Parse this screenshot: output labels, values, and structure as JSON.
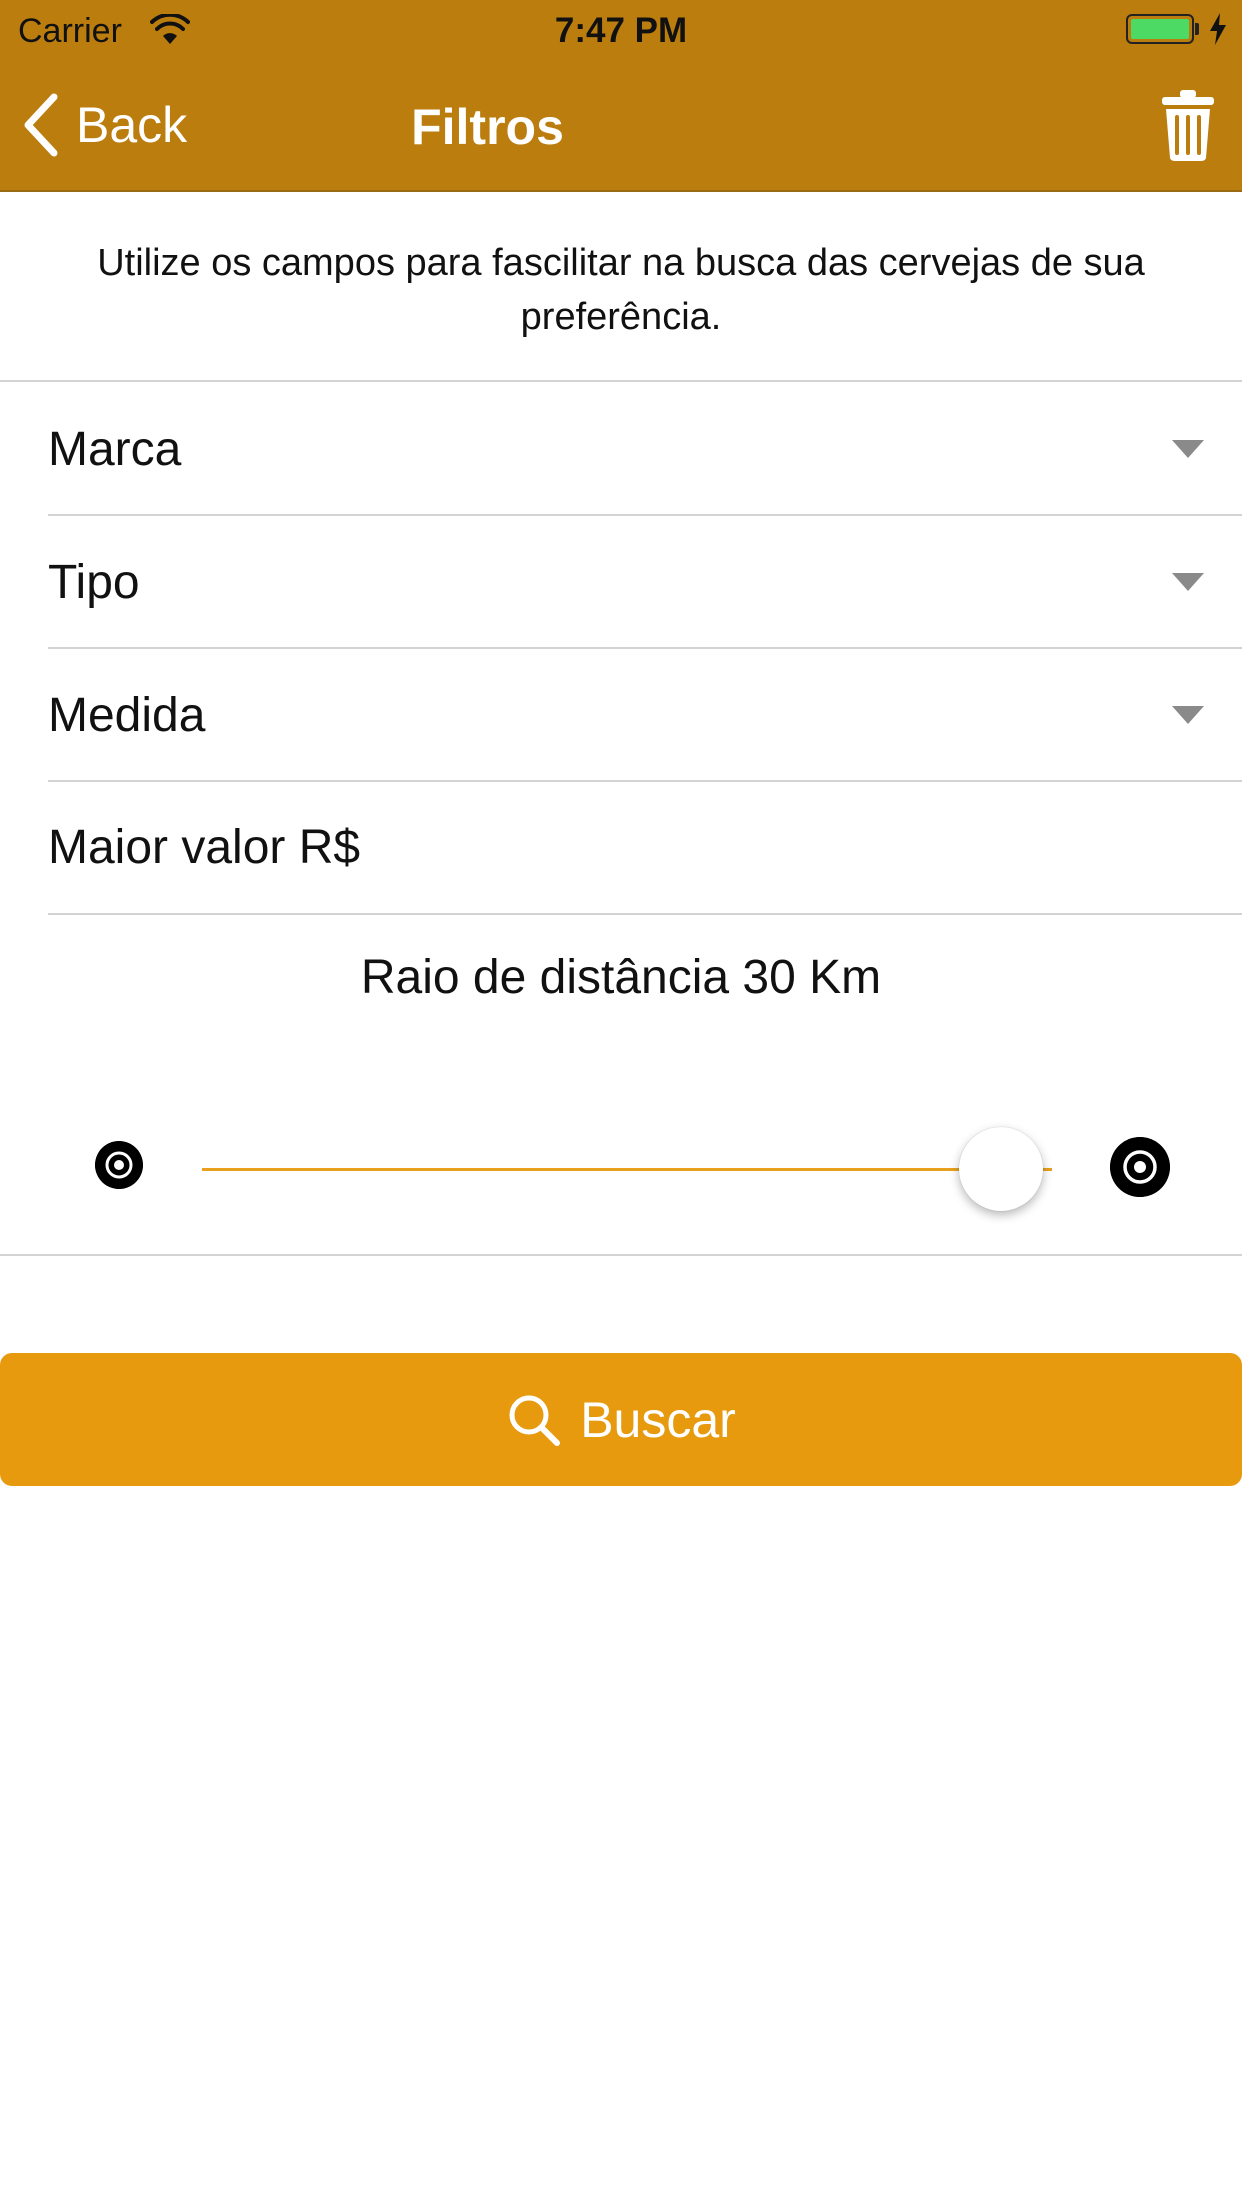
{
  "status_bar": {
    "carrier": "Carrier",
    "time": "7:47 PM",
    "icons": [
      "wifi-icon",
      "battery-icon",
      "charging-bolt-icon"
    ]
  },
  "nav": {
    "back_label": "Back",
    "title": "Filtros",
    "trash_icon": "trash-icon",
    "bar_color": "#bb7d0e"
  },
  "intro": "Utilize os campos para fascilitar na busca das cervejas de sua preferência.",
  "filters": {
    "marca": "Marca",
    "tipo": "Tipo",
    "medida": "Medida",
    "max_price_placeholder": "Maior valor R$"
  },
  "distance": {
    "label": "Raio de distância 30 Km",
    "value": 30,
    "unit": "Km",
    "slider_fraction": 0.94,
    "min_icon": "target-small-icon",
    "max_icon": "target-large-icon",
    "track_color": "#e8a11f"
  },
  "search_button": {
    "label": "Buscar",
    "icon": "search-icon",
    "color": "#e89a0f"
  }
}
